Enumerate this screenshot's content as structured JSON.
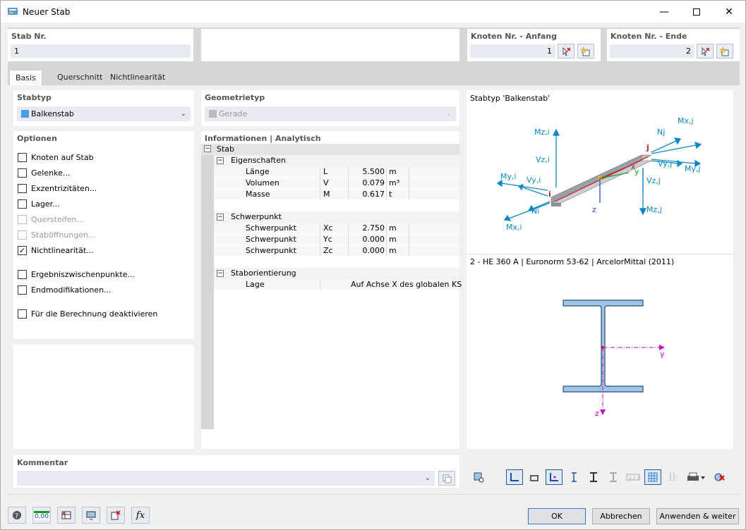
{
  "window": {
    "title": "Neuer Stab"
  },
  "header": {
    "member_no_label": "Stab Nr.",
    "member_no_value": "1",
    "node_start_label": "Knoten Nr. - Anfang",
    "node_start_value": "1",
    "node_end_label": "Knoten Nr. - Ende",
    "node_end_value": "2"
  },
  "tabs": [
    "Basis",
    "Querschnitt",
    "Nichtlinearität"
  ],
  "stabtyp": {
    "label": "Stabtyp",
    "value": "Balkenstab",
    "color": "#4a9ee8"
  },
  "geometrietyp": {
    "label": "Geometrietyp",
    "value": "Gerade"
  },
  "optionen": {
    "label": "Optionen",
    "items": [
      {
        "label": "Knoten auf Stab",
        "checked": false,
        "enabled": true
      },
      {
        "label": "Gelenke...",
        "checked": false,
        "enabled": true
      },
      {
        "label": "Exzentrizitäten...",
        "checked": false,
        "enabled": true
      },
      {
        "label": "Lager...",
        "checked": false,
        "enabled": true
      },
      {
        "label": "Quersteifen...",
        "checked": false,
        "enabled": false
      },
      {
        "label": "Staböffnungen...",
        "checked": false,
        "enabled": false
      },
      {
        "label": "Nichtlinearität...",
        "checked": true,
        "enabled": true
      },
      {
        "label": "Ergebniszwischenpunkte...",
        "checked": false,
        "enabled": true
      },
      {
        "label": "Endmodifikationen...",
        "checked": false,
        "enabled": true
      },
      {
        "label": "Für die Berechnung deaktivieren",
        "checked": false,
        "enabled": true
      }
    ]
  },
  "info": {
    "label": "Informationen | Analytisch",
    "root": "Stab",
    "groups": [
      {
        "name": "Eigenschaften",
        "rows": [
          {
            "name": "Länge",
            "sym": "L",
            "val": "5.500",
            "unit": "m"
          },
          {
            "name": "Volumen",
            "sym": "V",
            "val": "0.079",
            "unit": "m³"
          },
          {
            "name": "Masse",
            "sym": "M",
            "val": "0.617",
            "unit": "t"
          }
        ]
      },
      {
        "name": "Schwerpunkt",
        "rows": [
          {
            "name": "Schwerpunkt",
            "sym": "Xc",
            "val": "2.750",
            "unit": "m"
          },
          {
            "name": "Schwerpunkt",
            "sym": "Yc",
            "val": "0.000",
            "unit": "m"
          },
          {
            "name": "Schwerpunkt",
            "sym": "Zc",
            "val": "0.000",
            "unit": "m"
          }
        ]
      },
      {
        "name": "Staborientierung",
        "rows": [
          {
            "name": "Lage",
            "sym": "",
            "val": "Auf Achse X des globalen KS",
            "unit": ""
          }
        ]
      }
    ]
  },
  "preview": {
    "title": "Stabtyp 'Balkenstab'",
    "section_title": "2 - HE 360 A | Euronorm 53-62 | ArcelorMittal (2011)",
    "force_labels": {
      "mzi": "Mz,i",
      "vzi": "Vz,i",
      "myi": "My,i",
      "vyi": "Vy,i",
      "ni": "Ni",
      "mxi": "Mx,i",
      "mxj": "Mx,j",
      "nj": "Nj",
      "vyj": "Vy,j",
      "myj": "My,j",
      "vzj": "Vz,j",
      "mzj": "Mz,j",
      "i": "i",
      "j": "j",
      "x": "x",
      "y": "y",
      "z": "z"
    },
    "section_axes": {
      "y": "y",
      "z": "z"
    }
  },
  "kommentar": {
    "label": "Kommentar",
    "value": ""
  },
  "footer": {
    "ok": "OK",
    "cancel": "Abbrechen",
    "apply": "Anwenden & weiter",
    "units_badge": "0,00"
  },
  "colors": {
    "accent": "#0a88c8",
    "section_fill": "#9ec5e8",
    "axis_magenta": "#d000d0"
  }
}
